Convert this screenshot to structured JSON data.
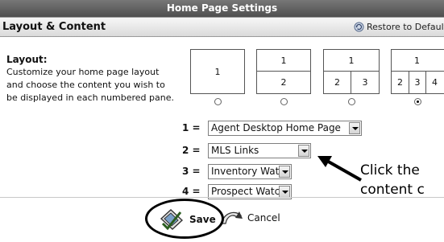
{
  "window": {
    "title": "Home Page Settings"
  },
  "section": {
    "title": "Layout & Content",
    "restore_label": "Restore to Defaults"
  },
  "description": {
    "label": "Layout:",
    "lines": [
      "Customize your home page layout",
      "and choose the content you wish to",
      "be displayed in each numbered pane."
    ]
  },
  "layouts": [
    {
      "rows": [
        [
          "1"
        ]
      ],
      "selected": false
    },
    {
      "rows": [
        [
          "1"
        ],
        [
          "2"
        ]
      ],
      "selected": false
    },
    {
      "rows": [
        [
          "1"
        ],
        [
          "2",
          "3"
        ]
      ],
      "selected": false
    },
    {
      "rows": [
        [
          "1"
        ],
        [
          "2",
          "3",
          "4"
        ]
      ],
      "selected": true
    }
  ],
  "panes": [
    {
      "label": "1 =",
      "value": "Agent Desktop Home Page"
    },
    {
      "label": "2 =",
      "value": "MLS Links"
    },
    {
      "label": "3 =",
      "value": "Inventory Watch"
    },
    {
      "label": "4 =",
      "value": "Prospect Watch"
    }
  ],
  "annotation": {
    "line1": "Click the",
    "line2": "content c"
  },
  "buttons": {
    "save": "Save",
    "cancel": "Cancel"
  },
  "colors": {
    "titlebar": "#5e5e5e",
    "annotation": "#000000"
  },
  "icons": [
    "restore-icon",
    "save-icon",
    "cancel-icon",
    "arrow-icon"
  ]
}
